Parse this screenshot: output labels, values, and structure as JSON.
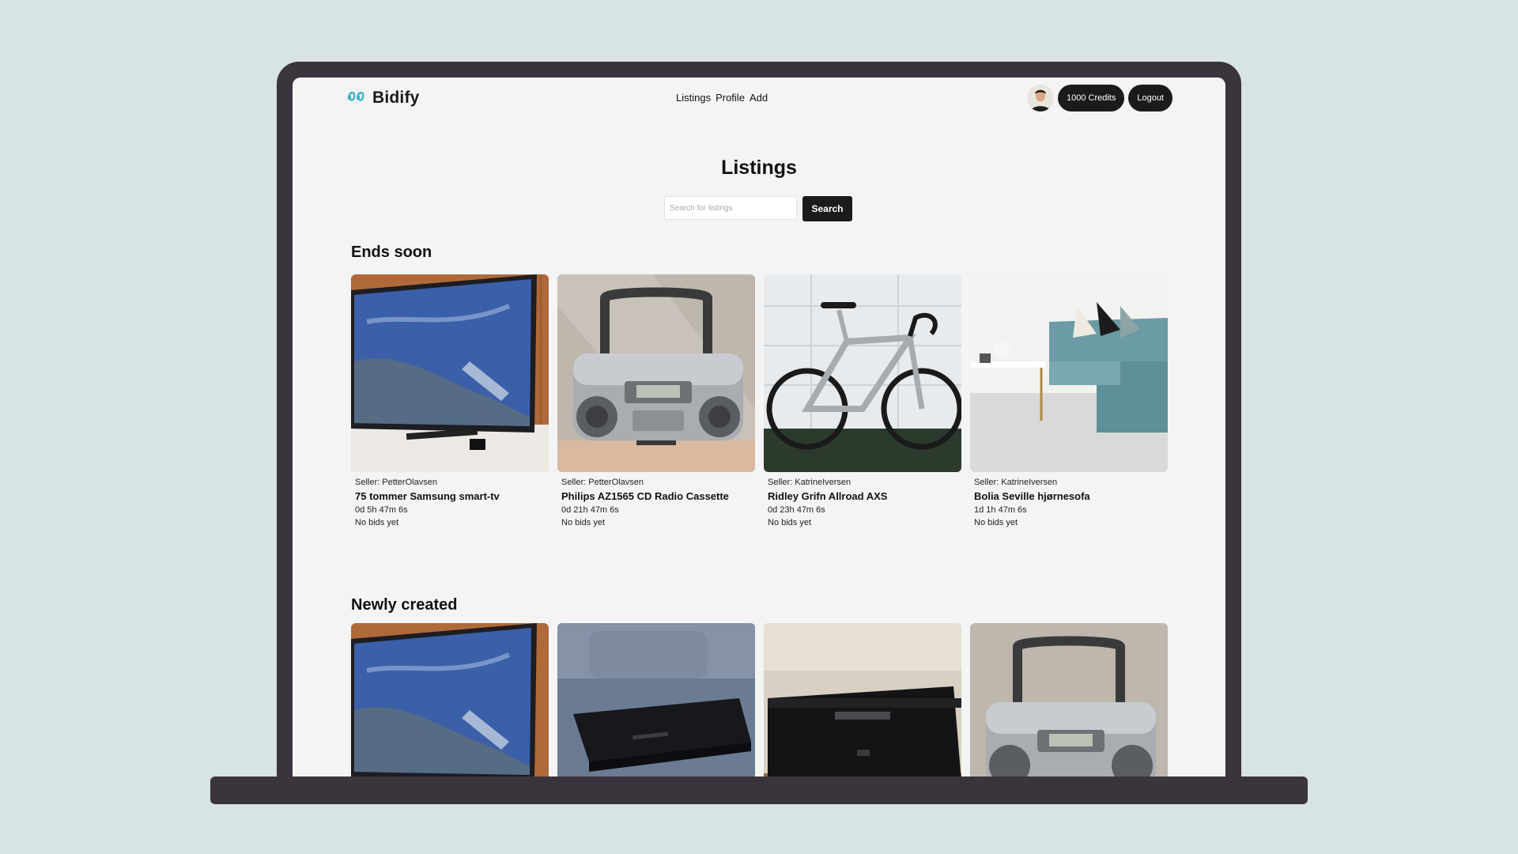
{
  "brand": {
    "name": "Bidify",
    "logo_icon": "bidify-logo-icon",
    "accent": "#3ab3c7"
  },
  "nav": {
    "items": [
      "Listings",
      "Profile",
      "Add"
    ]
  },
  "account": {
    "credits_label": "1000 Credits",
    "logout_label": "Logout"
  },
  "page": {
    "title": "Listings"
  },
  "search": {
    "placeholder": "Search for listings",
    "button_label": "Search"
  },
  "sections": [
    {
      "title": "Ends soon",
      "listings": [
        {
          "seller": "Seller: PetterOlavsen",
          "title": "75 tommer Samsung smart-tv",
          "time_left": "0d 5h 47m 6s",
          "bids": "No bids yet",
          "image": "tv"
        },
        {
          "seller": "Seller: PetterOlavsen",
          "title": "Philips AZ1565 CD Radio Cassette",
          "time_left": "0d 21h 47m 6s",
          "bids": "No bids yet",
          "image": "boombox"
        },
        {
          "seller": "Seller: KatrineIversen",
          "title": "Ridley Grifn Allroad AXS",
          "time_left": "0d 23h 47m 6s",
          "bids": "No bids yet",
          "image": "bicycle"
        },
        {
          "seller": "Seller: KatrineIversen",
          "title": "Bolia Seville hjørnesofa",
          "time_left": "1d 1h 47m 6s",
          "bids": "No bids yet",
          "image": "sofa"
        }
      ]
    },
    {
      "title": "Newly created",
      "listings": [
        {
          "image": "tv"
        },
        {
          "image": "cd-player"
        },
        {
          "image": "amplifier"
        },
        {
          "image": "boombox"
        }
      ]
    }
  ]
}
